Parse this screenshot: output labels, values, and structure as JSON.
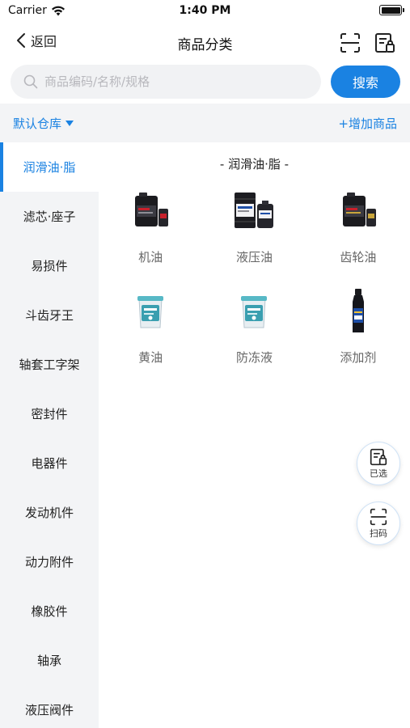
{
  "status_bar": {
    "carrier": "Carrier",
    "time": "1:40 PM"
  },
  "nav": {
    "back_label": "返回",
    "title": "商品分类",
    "icons": [
      "scan-icon",
      "list-icon"
    ]
  },
  "search": {
    "placeholder": "商品编码/名称/规格",
    "value": "",
    "button_label": "搜索"
  },
  "toolbar": {
    "warehouse_label": "默认仓库",
    "add_label": "+增加商品"
  },
  "accent_color": "#1a82e2",
  "sidebar": {
    "active_index": 0,
    "items": [
      {
        "label": "润滑油·脂"
      },
      {
        "label": "滤芯·座子"
      },
      {
        "label": "易损件"
      },
      {
        "label": "斗齿牙王"
      },
      {
        "label": "轴套工字架"
      },
      {
        "label": "密封件"
      },
      {
        "label": "电器件"
      },
      {
        "label": "发动机件"
      },
      {
        "label": "动力附件"
      },
      {
        "label": "橡胶件"
      },
      {
        "label": "轴承"
      },
      {
        "label": "液压阀件"
      }
    ]
  },
  "content": {
    "section_title": "- 润滑油·脂 -",
    "categories": [
      {
        "label": "机油",
        "icon": "engine-oil-can-icon"
      },
      {
        "label": "液压油",
        "icon": "hydraulic-oil-drum-icon"
      },
      {
        "label": "齿轮油",
        "icon": "gear-oil-can-icon"
      },
      {
        "label": "黄油",
        "icon": "grease-bucket-icon"
      },
      {
        "label": "防冻液",
        "icon": "antifreeze-bucket-icon"
      },
      {
        "label": "添加剂",
        "icon": "additive-bottle-icon"
      }
    ]
  },
  "fabs": {
    "selected_label": "已选",
    "scan_label": "扫码"
  }
}
